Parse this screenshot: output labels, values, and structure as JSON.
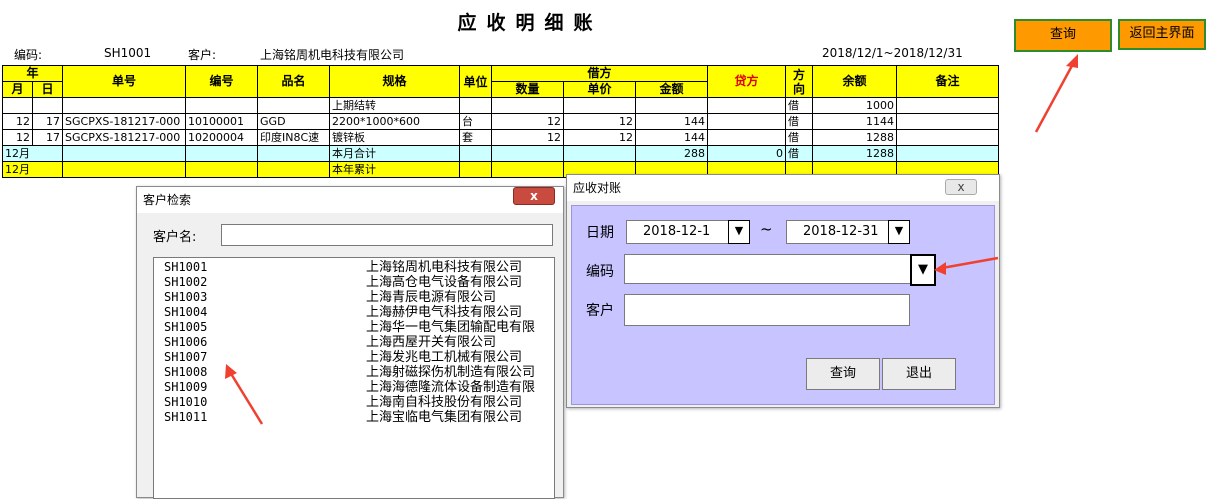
{
  "sheet": {
    "title": "应收明细账",
    "code_label": "编码:",
    "code_value": "SH1001",
    "customer_label": "客户:",
    "customer_value": "上海铭周机电科技有限公司",
    "date_range": "2018/12/1~2018/12/31"
  },
  "table": {
    "headers": {
      "year": "年",
      "month": "月",
      "day": "日",
      "doc_no": "单号",
      "item_code": "编号",
      "product": "品名",
      "spec": "规格",
      "unit": "单位",
      "debit": "借方",
      "qty": "数量",
      "price": "单价",
      "amount": "金额",
      "credit": "贷方",
      "direction": "方向",
      "balance": "余额",
      "remark": "备注"
    },
    "rows": [
      {
        "month": "",
        "day": "",
        "doc": "",
        "code": "",
        "product": "",
        "spec": "上期结转",
        "unit": "",
        "qty": "",
        "price": "",
        "amount": "",
        "credit": "",
        "dir": "借",
        "balance": "1000",
        "remark": ""
      },
      {
        "month": "12",
        "day": "17",
        "doc": "SGCPXS-181217-000",
        "code": "10100001",
        "product": "GGD",
        "spec": "2200*1000*600",
        "unit": "台",
        "qty": "12",
        "price": "12",
        "amount": "144",
        "credit": "",
        "dir": "借",
        "balance": "1144",
        "remark": ""
      },
      {
        "month": "12",
        "day": "17",
        "doc": "SGCPXS-181217-000",
        "code": "10200004",
        "product": "印度IN8C速",
        "spec": "镀锌板",
        "unit": "套",
        "qty": "12",
        "price": "12",
        "amount": "144",
        "credit": "",
        "dir": "借",
        "balance": "1288",
        "remark": ""
      }
    ],
    "month_total": {
      "month": "12月",
      "spec": "本月合计",
      "amount": "288",
      "credit": "0",
      "dir": "借",
      "balance": "1288"
    },
    "year_total": {
      "month": "12月",
      "spec": "本年累计"
    }
  },
  "buttons": {
    "query": "查询",
    "back_main": "返回主界面"
  },
  "customer_search": {
    "title": "客户检索",
    "close": "x",
    "name_label": "客户名:",
    "name_value": "",
    "items": [
      {
        "code": "SH1001",
        "name": "上海铭周机电科技有限公司"
      },
      {
        "code": "SH1002",
        "name": "上海高仓电气设备有限公司"
      },
      {
        "code": "SH1003",
        "name": "上海青辰电源有限公司"
      },
      {
        "code": "SH1004",
        "name": "上海赫伊电气科技有限公司"
      },
      {
        "code": "SH1005",
        "name": "上海华一电气集团输配电有限"
      },
      {
        "code": "SH1006",
        "name": "上海西屋开关有限公司"
      },
      {
        "code": "SH1007",
        "name": "上海发兆电工机械有限公司"
      },
      {
        "code": "SH1008",
        "name": "上海射磁探伤机制造有限公司"
      },
      {
        "code": "SH1009",
        "name": "上海海德隆流体设备制造有限"
      },
      {
        "code": "SH1010",
        "name": "上海南自科技股份有限公司"
      },
      {
        "code": "SH1011",
        "name": "上海宝临电气集团有限公司"
      }
    ]
  },
  "reconcile": {
    "title": "应收对账",
    "close": "x",
    "date_label": "日期",
    "date_from": "2018-12-1",
    "tilde": "~",
    "date_to": "2018-12-31",
    "code_label": "编码",
    "code_value": "",
    "customer_label": "客户",
    "customer_value": "",
    "dropdown_glyph": "▼",
    "query": "查询",
    "exit": "退出"
  }
}
